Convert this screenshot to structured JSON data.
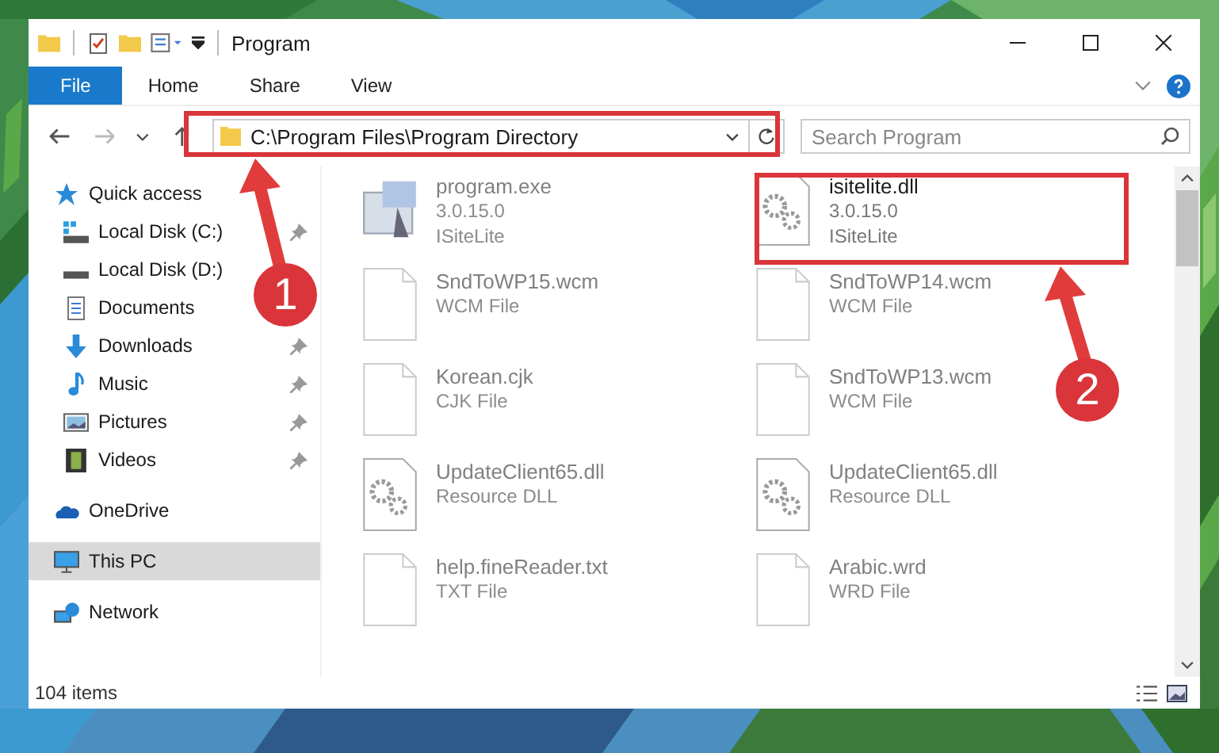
{
  "window": {
    "title": "Program"
  },
  "ribbon_tabs": [
    {
      "label": "File",
      "selected": true
    },
    {
      "label": "Home",
      "selected": false
    },
    {
      "label": "Share",
      "selected": false
    },
    {
      "label": "View",
      "selected": false
    }
  ],
  "address": {
    "value": "C:\\Program Files\\Program Directory"
  },
  "search": {
    "placeholder": "Search Program"
  },
  "sidebar": {
    "items": [
      {
        "label": "Quick access",
        "kind": "star",
        "selected": false,
        "children": [
          {
            "label": "Local Disk (C:)",
            "kind": "drive-c",
            "pinned": true,
            "selected": false
          },
          {
            "label": "Local Disk (D:)",
            "kind": "drive",
            "pinned": false,
            "selected": false
          },
          {
            "label": "Documents",
            "kind": "document",
            "pinned": false,
            "selected": false
          },
          {
            "label": "Downloads",
            "kind": "download",
            "pinned": true,
            "selected": false
          },
          {
            "label": "Music",
            "kind": "music",
            "pinned": true,
            "selected": false
          },
          {
            "label": "Pictures",
            "kind": "pictures",
            "pinned": true,
            "selected": false
          },
          {
            "label": "Videos",
            "kind": "videos",
            "pinned": true,
            "selected": false
          }
        ]
      },
      {
        "label": "OneDrive",
        "kind": "cloud",
        "selected": false
      },
      {
        "label": "This PC",
        "kind": "pc",
        "selected": true
      },
      {
        "label": "Network",
        "kind": "network",
        "selected": false
      }
    ]
  },
  "files": [
    {
      "name": "program.exe",
      "details": [
        "3.0.15.0",
        "ISiteLite"
      ],
      "kind": "exe",
      "faded": true
    },
    {
      "name": "isitelite.dll",
      "details": [
        "3.0.15.0",
        "ISiteLite"
      ],
      "kind": "dll",
      "faded": false
    },
    {
      "name": "SndToWP15.wcm",
      "details": [
        "WCM File"
      ],
      "kind": "blank",
      "faded": true
    },
    {
      "name": "SndToWP14.wcm",
      "details": [
        "WCM File"
      ],
      "kind": "blank",
      "faded": true
    },
    {
      "name": "Korean.cjk",
      "details": [
        "CJK File"
      ],
      "kind": "blank",
      "faded": true
    },
    {
      "name": "SndToWP13.wcm",
      "details": [
        "WCM File"
      ],
      "kind": "blank",
      "faded": true
    },
    {
      "name": "UpdateClient65.dll",
      "details": [
        "Resource DLL"
      ],
      "kind": "dll",
      "faded": true
    },
    {
      "name": "UpdateClient65.dll",
      "details": [
        "Resource DLL"
      ],
      "kind": "dll",
      "faded": true
    },
    {
      "name": "help.fineReader.txt",
      "details": [
        "TXT File"
      ],
      "kind": "blank",
      "faded": true
    },
    {
      "name": "Arabic.wrd",
      "details": [
        "WRD File"
      ],
      "kind": "blank",
      "faded": true
    }
  ],
  "status_bar": {
    "text": "104 items"
  },
  "annotations": [
    {
      "label": "1"
    },
    {
      "label": "2"
    }
  ]
}
